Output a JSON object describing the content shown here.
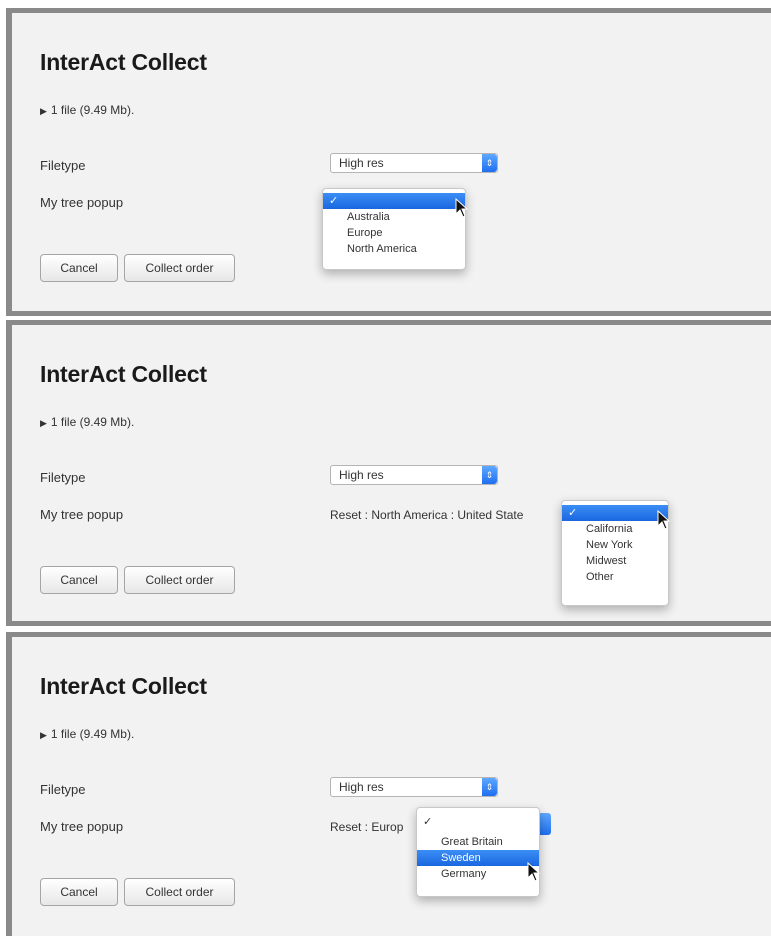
{
  "panels": [
    {
      "title": "InterAct Collect",
      "file_info": "1 file (9.49 Mb).",
      "filetype_label": "Filetype",
      "filetype_value": "High res",
      "tree_label": "My tree popup",
      "breadcrumb": "",
      "menu": {
        "checked": "✓",
        "items": [
          "Australia",
          "Europe",
          "North America"
        ]
      },
      "cancel_label": "Cancel",
      "collect_label": "Collect order"
    },
    {
      "title": "InterAct Collect",
      "file_info": "1 file (9.49 Mb).",
      "filetype_label": "Filetype",
      "filetype_value": "High res",
      "tree_label": "My tree popup",
      "breadcrumb": "Reset : North America : United State",
      "menu": {
        "checked": "✓",
        "items": [
          "California",
          "New York",
          "Midwest",
          "Other"
        ]
      },
      "cancel_label": "Cancel",
      "collect_label": "Collect order"
    },
    {
      "title": "InterAct Collect",
      "file_info": "1 file (9.49 Mb).",
      "filetype_label": "Filetype",
      "filetype_value": "High res",
      "tree_label": "My tree popup",
      "breadcrumb": "Reset : Europ",
      "menu": {
        "checked": "✓",
        "items": [
          "Great Britain",
          "Sweden",
          "Germany"
        ],
        "highlighted": "Sweden"
      },
      "cancel_label": "Cancel",
      "collect_label": "Collect order"
    }
  ],
  "colors": {
    "accent": "#1f6ff0",
    "panel_bg": "#f2f2f2",
    "frame": "#8a8a8a"
  },
  "icons": {
    "disclosure": "disclosure-triangle-icon",
    "select_arrow": "select-stepper-icon",
    "pointer": "mouse-pointer-icon"
  }
}
